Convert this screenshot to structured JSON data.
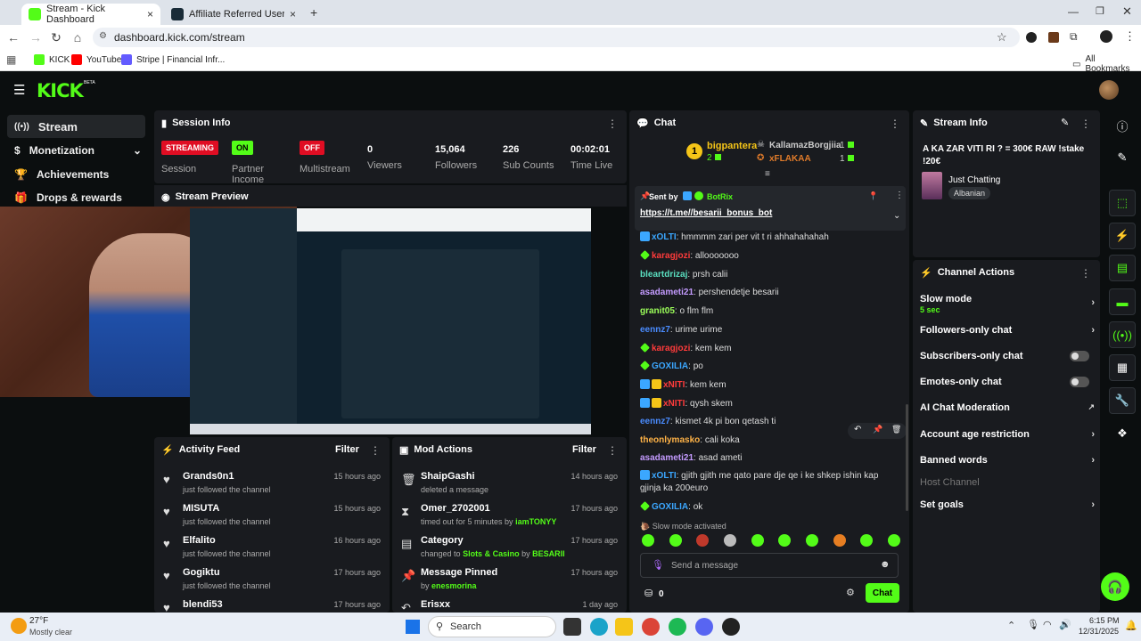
{
  "browser": {
    "tabs": [
      {
        "title": "Stream - Kick Dashboard"
      },
      {
        "title": "Affiliate Referred Users - Stake"
      }
    ],
    "url": "dashboard.kick.com/stream",
    "bookmarks": [
      "KICK",
      "YouTube",
      "Stripe | Financial Infr..."
    ],
    "all_bookmarks": "All Bookmarks"
  },
  "app": {
    "logo": "KICK",
    "logo_tag": "BETA",
    "sidebar": [
      {
        "label": "Stream"
      },
      {
        "label": "Monetization"
      },
      {
        "label": "Achievements"
      },
      {
        "label": "Drops & rewards"
      }
    ]
  },
  "session": {
    "title": "Session Info",
    "stats": [
      {
        "pill": "STREAMING",
        "label": "Session"
      },
      {
        "pill": "ON",
        "label": "Partner Income"
      },
      {
        "pill": "OFF",
        "label": "Multistream"
      },
      {
        "value": "0",
        "label": "Viewers"
      },
      {
        "value": "15,064",
        "label": "Followers"
      },
      {
        "value": "226",
        "label": "Sub Counts"
      },
      {
        "value": "00:02:01",
        "label": "Time Live"
      }
    ]
  },
  "preview": {
    "title": "Stream Preview"
  },
  "activity": {
    "title": "Activity Feed",
    "filter": "Filter",
    "items": [
      {
        "name": "Grands0n1",
        "desc": "just followed the channel",
        "time": "15 hours ago"
      },
      {
        "name": "MISUTA",
        "desc": "just followed the channel",
        "time": "15 hours ago"
      },
      {
        "name": "Elfalito",
        "desc": "just followed the channel",
        "time": "16 hours ago"
      },
      {
        "name": "Gogiktu",
        "desc": "just followed the channel",
        "time": "17 hours ago"
      },
      {
        "name": "blendi53",
        "desc": "",
        "time": "17 hours ago"
      }
    ]
  },
  "mod": {
    "title": "Mod Actions",
    "filter": "Filter",
    "items": [
      {
        "name": "ShaipGashi",
        "desc": "deleted a message",
        "time": "14 hours ago",
        "icon": "trash-icon"
      },
      {
        "name": "Omer_2702001",
        "desc": "timed out for 5 minutes by",
        "by": "iamTONYY",
        "time": "17 hours ago",
        "icon": "hourglass-icon"
      },
      {
        "name": "Category",
        "desc": "changed to",
        "cat": "Slots & Casino",
        "by_word": "by",
        "by": "BESARII",
        "time": "17 hours ago",
        "icon": "category-icon"
      },
      {
        "name": "Message Pinned",
        "desc": "by",
        "by": "enesmorina",
        "time": "17 hours ago",
        "icon": "pin-icon"
      },
      {
        "name": "Erisxx",
        "desc": "",
        "time": "1 day ago",
        "icon": "undo-icon"
      }
    ]
  },
  "chat": {
    "title": "Chat",
    "leaders": [
      {
        "rank": "1",
        "name": "bigpantera",
        "count": "2"
      },
      {
        "name": "KallamazBorgjiia",
        "count": "1"
      },
      {
        "name": "xFLAKAA",
        "count": "1"
      }
    ],
    "pinned": {
      "sent_by": "Sent by",
      "user": "BotRix",
      "link": "https://t.me//besarii_bonus_bot"
    },
    "messages": [
      {
        "user": "xOLTI",
        "color": "#3ba7ff",
        "text": "hmmmm zari per vit t ri ahhahahahah"
      },
      {
        "user": "karagjozi",
        "color": "#ff3b3b",
        "text": "allooooooo"
      },
      {
        "user": "bleartdrizaj",
        "color": "#5adfc0",
        "text": "prsh calii"
      },
      {
        "user": "asadameti21",
        "color": "#c49bff",
        "text": "pershendetje besarii"
      },
      {
        "user": "granit05",
        "color": "#9cff5a",
        "text": "o flm flm"
      },
      {
        "user": "eennz7",
        "color": "#4a8cff",
        "text": "urime urime"
      },
      {
        "user": "karagjozi",
        "color": "#ff3b3b",
        "text": "kem kem"
      },
      {
        "user": "GOXILIA",
        "color": "#3ba7ff",
        "text": "po"
      },
      {
        "user": "xNITI",
        "color": "#ff3b3b",
        "text": "kem kem"
      },
      {
        "user": "xNITI",
        "color": "#ff3b3b",
        "text": "qysh skem"
      },
      {
        "user": "eennz7",
        "color": "#4a8cff",
        "text": "kismet 4k pi bon qetash ti"
      },
      {
        "user": "theonlymasko",
        "color": "#ffb347",
        "text": "cali koka"
      },
      {
        "user": "asadameti21",
        "color": "#c49bff",
        "text": "asad ameti"
      },
      {
        "user": "xOLTI",
        "color": "#3ba7ff",
        "text": "gjith gjith me qato pare dje qe i ke shkep ishin kap gjinja ka 200euro"
      },
      {
        "user": "GOXILIA",
        "color": "#3ba7ff",
        "text": "ok"
      }
    ],
    "slow_notice": "Slow mode activated",
    "placeholder": "Send a message",
    "points": "0",
    "send": "Chat"
  },
  "stream_info": {
    "title": "Stream Info",
    "stream_title": "A KA ZAR VITI RI ? = 300€ RAW !stake !20€",
    "category": "Just Chatting",
    "tag": "Albanian"
  },
  "channel_actions": {
    "title": "Channel Actions",
    "slow_mode": {
      "label": "Slow mode",
      "value": "5 sec"
    },
    "followers_only": "Followers-only chat",
    "subscribers_only": "Subscribers-only chat",
    "emotes_only": "Emotes-only chat",
    "ai_mod": "AI Chat Moderation",
    "age": "Account age restriction",
    "banned": "Banned words",
    "host": "Host Channel",
    "goals": "Set goals"
  },
  "taskbar": {
    "temp": "27°F",
    "weather": "Mostly clear",
    "search": "Search",
    "time": "6:15 PM",
    "date": "12/31/2025"
  },
  "colors": {
    "brand": "#53fc18",
    "panel": "#191b1f",
    "bg": "#0b0e0f"
  }
}
